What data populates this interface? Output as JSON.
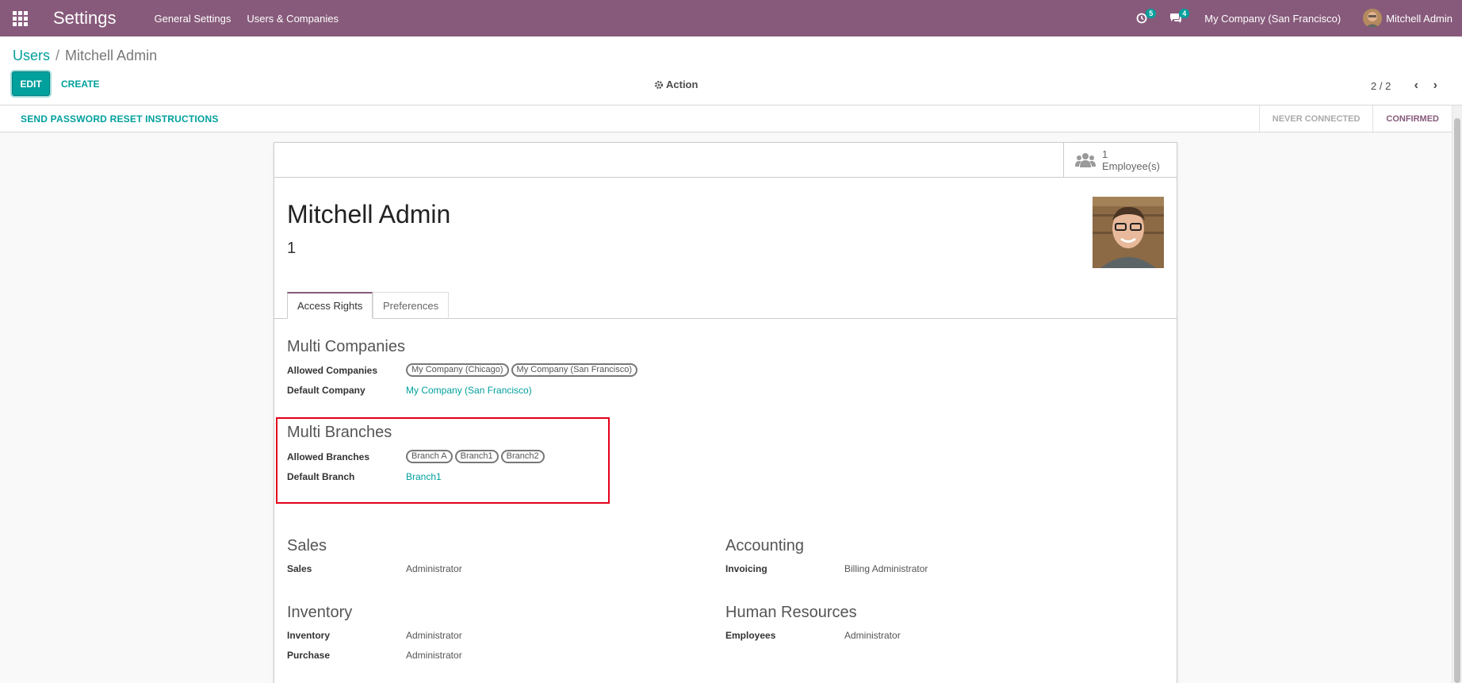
{
  "navbar": {
    "app_title": "Settings",
    "menus": [
      "General Settings",
      "Users & Companies"
    ],
    "activity_count": "5",
    "messages_count": "4",
    "company": "My Company (San Francisco)",
    "user": "Mitchell Admin",
    "color": "#875a7b"
  },
  "breadcrumb": {
    "parent": "Users",
    "separator": "/",
    "current": "Mitchell Admin"
  },
  "controls": {
    "edit_label": "EDIT",
    "create_label": "CREATE",
    "action_label": "Action",
    "pager": "2 / 2"
  },
  "statusbar": {
    "reset_label": "SEND PASSWORD RESET INSTRUCTIONS",
    "steps": [
      "NEVER CONNECTED",
      "CONFIRMED"
    ],
    "active_step": "CONFIRMED"
  },
  "form": {
    "employee_count": "1",
    "employee_label": "Employee(s)",
    "name": "Mitchell Admin",
    "login": "1",
    "tabs": [
      "Access Rights",
      "Preferences"
    ],
    "multi_companies": {
      "title": "Multi Companies",
      "allowed_label": "Allowed Companies",
      "allowed": [
        "My Company (Chicago)",
        "My Company (San Francisco)"
      ],
      "default_label": "Default Company",
      "default": "My Company (San Francisco)"
    },
    "multi_branches": {
      "title": "Multi Branches",
      "allowed_label": "Allowed Branches",
      "allowed": [
        "Branch A",
        "Branch1",
        "Branch2"
      ],
      "default_label": "Default Branch",
      "default": "Branch1"
    },
    "sales": {
      "title": "Sales",
      "label": "Sales",
      "value": "Administrator"
    },
    "accounting": {
      "title": "Accounting",
      "label": "Invoicing",
      "value": "Billing Administrator"
    },
    "inventory": {
      "title": "Inventory",
      "rows": [
        {
          "label": "Inventory",
          "value": "Administrator"
        },
        {
          "label": "Purchase",
          "value": "Administrator"
        }
      ]
    },
    "hr": {
      "title": "Human Resources",
      "label": "Employees",
      "value": "Administrator"
    }
  },
  "colors": {
    "accent": "#00a09d",
    "brand": "#875a7b",
    "highlight": "#e3001b"
  },
  "icons": [
    "apps-grid-icon",
    "activity-clock-icon",
    "chat-icon",
    "gear-icon",
    "chevron-left-icon",
    "chevron-right-icon",
    "users-icon"
  ]
}
